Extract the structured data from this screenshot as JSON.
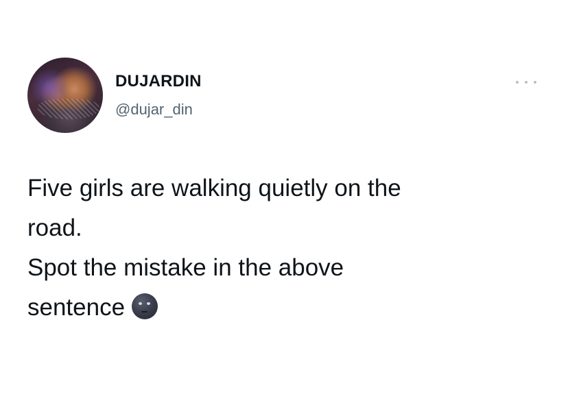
{
  "tweet": {
    "author": {
      "display_name": "DUJARDIN",
      "handle": "@dujar_din"
    },
    "text_lines": [
      "Five girls are walking quietly on the",
      "road.",
      "Spot the mistake in the above",
      "sentence"
    ],
    "trailing_emoji": "new-moon-face-emoji",
    "more_icon": "more-dots-icon"
  },
  "colors": {
    "text_primary": "#0f1419",
    "text_secondary": "#536471",
    "dots": "#b6bec6"
  }
}
